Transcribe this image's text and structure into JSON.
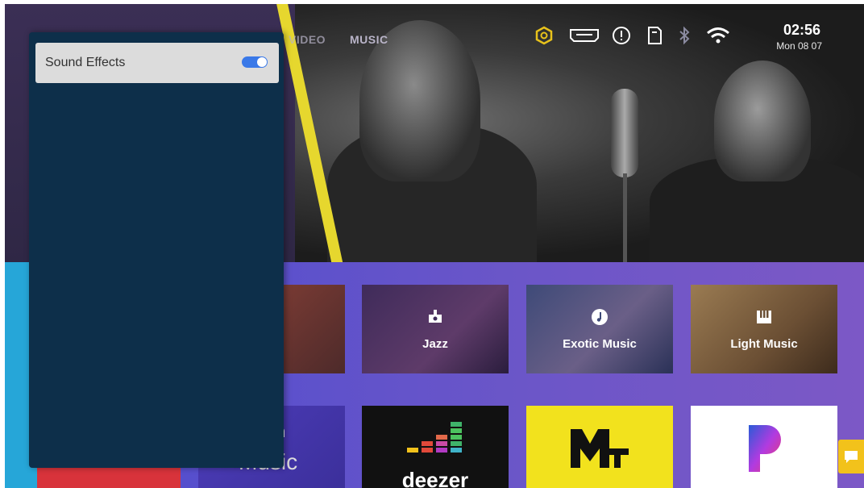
{
  "header": {
    "tabs": [
      {
        "label": "VIDEO"
      },
      {
        "label": "MUSIC"
      }
    ],
    "status_icons": [
      "settings-hex-icon",
      "hdmi-input-icon",
      "alert-icon",
      "sd-card-icon",
      "bluetooth-icon",
      "wifi-icon"
    ],
    "clock": {
      "time": "02:56",
      "date": "Mon 08 07"
    }
  },
  "sound_panel": {
    "items": [
      {
        "label": "Sound Effects",
        "enabled": true
      }
    ]
  },
  "categories": [
    {
      "label": "Jazz",
      "icon": "guitar-amp-icon"
    },
    {
      "label": "Exotic Music",
      "icon": "music-note-icon"
    },
    {
      "label": "Light Music",
      "icon": "piano-icon"
    }
  ],
  "apps": {
    "music_partial": [
      "on",
      "Music"
    ],
    "deezer": "deezer",
    "mtv": "MTV",
    "pandora": "P"
  },
  "colors": {
    "accent_yellow": "#e6d72e",
    "panel_bg": "#0d2f4a",
    "toggle_on": "#3a79e8"
  }
}
